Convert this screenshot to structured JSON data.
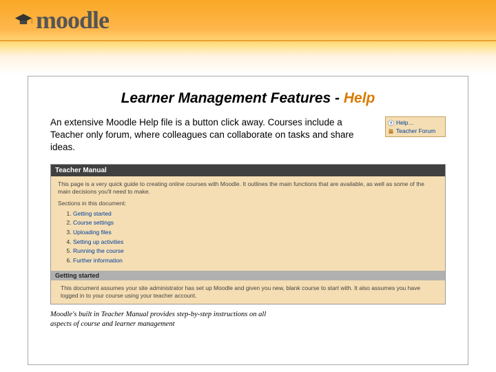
{
  "logo_text": "moodle",
  "title_main": "Learner Management Features - ",
  "title_help": "Help",
  "description": "An extensive Moodle Help file is a button click away. Courses include a Teacher only forum, where colleagues can collaborate on tasks and share ideas.",
  "side": {
    "help": "Help…",
    "forum": "Teacher Forum"
  },
  "manual": {
    "header": "Teacher Manual",
    "intro": "This page is a very quick guide to creating online courses with Moodle. It outlines the main functions that are available, as well as some of the main decisions you'll need to make.",
    "sections_label": "Sections in this document:",
    "items": [
      "Getting started",
      "Course settings",
      "Uploading files",
      "Setting up activities",
      "Running the course",
      "Further information"
    ],
    "subheader": "Getting started",
    "subbody": "This document assumes your site administrator has set up Moodle and given you new, blank course to start with. It also assumes you have logged in to your course using your teacher account."
  },
  "caption": "Moodle's built in Teacher Manual provides step-by-step instructions on all aspects of course and learner management"
}
